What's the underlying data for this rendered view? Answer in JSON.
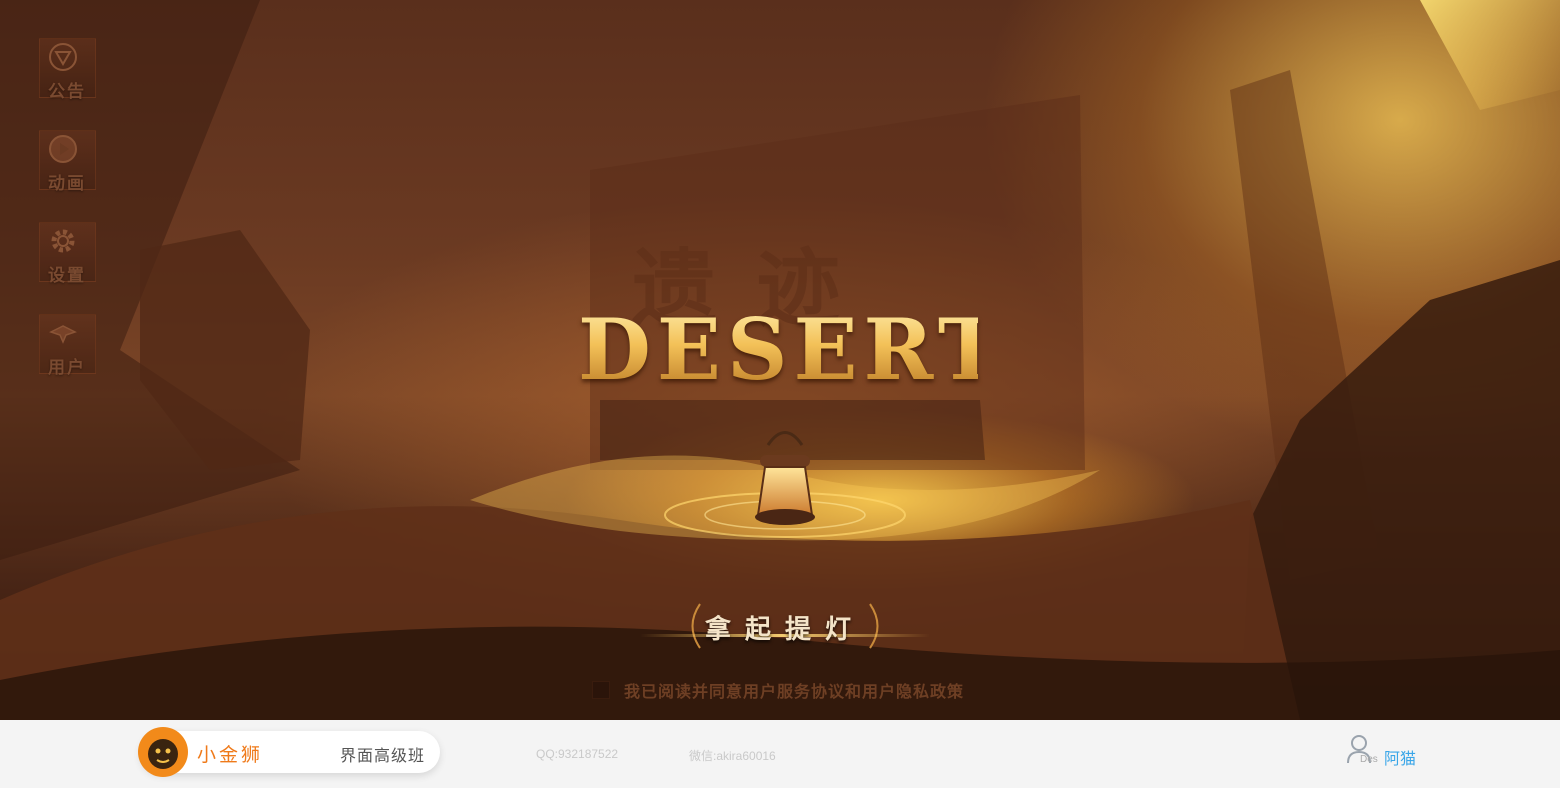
{
  "side_menu": {
    "items": [
      {
        "label": "公告",
        "icon": "triangle-emblem-icon"
      },
      {
        "label": "动画",
        "icon": "play-icon"
      },
      {
        "label": "设置",
        "icon": "gear-icon"
      },
      {
        "label": "用户",
        "icon": "moth-icon"
      }
    ]
  },
  "hero": {
    "background_title": "遗迹",
    "title": "DESERT",
    "start_button_label": "拿起提灯",
    "agreement_text": "我已阅读并同意用户服务协议和用户隐私政策"
  },
  "footer": {
    "brand_name": "小金狮",
    "course_name": "界面高级班",
    "qq": "QQ:932187522",
    "wechat": "微信:akira60016",
    "user_tag": "Des",
    "user_name": "阿猫"
  },
  "colors": {
    "accent_gold": "#f3c158",
    "brand_orange": "#ef7a1a",
    "user_blue": "#3aa6e8"
  }
}
